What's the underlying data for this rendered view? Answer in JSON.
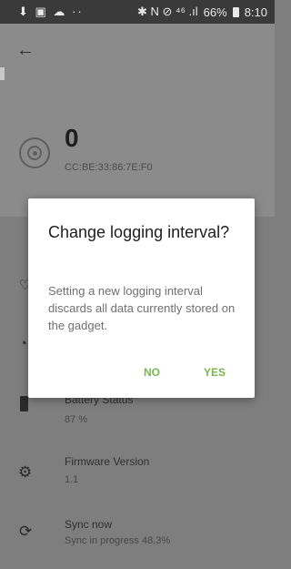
{
  "status_bar": {
    "left_icons": "⬇ ▣ ☁ ··",
    "right_icons": "✱ N ⊘ ⁴⁶ .ıl",
    "battery": "66%",
    "time": "8:10"
  },
  "device": {
    "value": "0",
    "mac": "CC:BE:33:86:7E:F0"
  },
  "list": {
    "battery_title": "Battery Status",
    "battery_value": "87 %",
    "firmware_title": "Firmware Version",
    "firmware_value": "1.1",
    "sync_title": "Sync now",
    "sync_status": "Sync in progress 48,3%"
  },
  "dialog": {
    "title": "Change logging interval?",
    "message": "Setting a new logging interval discards all data currently stored on the gadget.",
    "no_label": "NO",
    "yes_label": "YES"
  },
  "colors": {
    "accent_green": "#79b84e",
    "scrim": "#7e7e7e",
    "dialog_bg": "#ffffff"
  },
  "icons": {
    "back": "arrow-left-icon",
    "target": "target-icon",
    "battery": "battery-icon",
    "firmware": "chip-icon",
    "sync": "sync-icon"
  }
}
